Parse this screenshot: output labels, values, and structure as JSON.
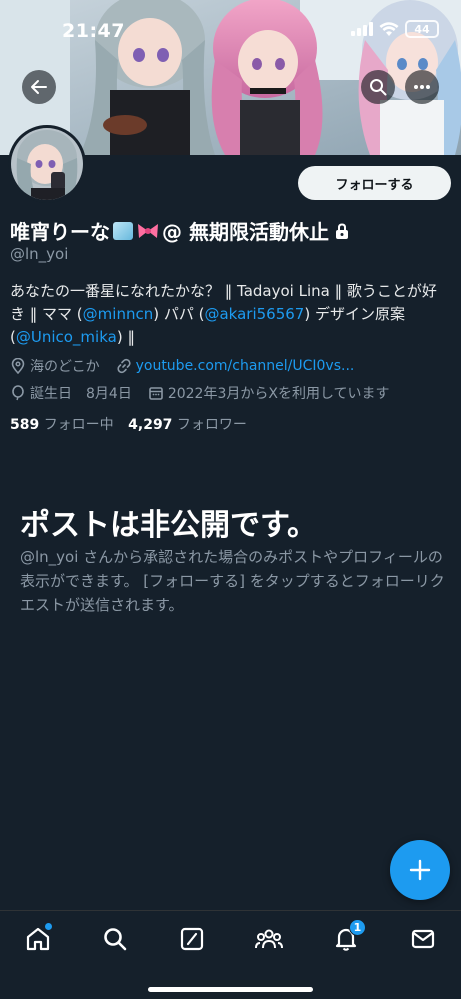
{
  "status_bar": {
    "time": "21:47",
    "battery": "44"
  },
  "header": {
    "back_icon": "arrow-left-icon",
    "search_icon": "search-icon",
    "more_icon": "more-horizontal-icon"
  },
  "profile": {
    "follow_label": "フォローする",
    "display_name_part1": "唯宵りーな",
    "display_name_part2": "@ 無期限活動休止",
    "handle": "@ln_yoi",
    "bio_text_1": "あなたの一番星になれたかな？ ‖ Tadayoi Lina ‖ 歌うことが好き ‖ ママ (",
    "bio_mention_1": "@minncn",
    "bio_text_2": ") パパ (",
    "bio_mention_2": "@akari56567",
    "bio_text_3": ") デザイン原案 (",
    "bio_mention_3": "@Unico_mika",
    "bio_text_4": ") ‖",
    "location": "海のどこか",
    "website": "youtube.com/channel/UCI0vs...",
    "birthday": "誕生日　8月4日",
    "joined": "2022年3月からXを利用しています",
    "following_count": "589",
    "following_label": "フォロー中",
    "followers_count": "4,297",
    "followers_label": "フォロワー"
  },
  "protected": {
    "title": "ポストは非公開です。",
    "description": "@ln_yoi さんから承認された場合のみポストやプロフィールの表示ができます。 [フォローする] をタップするとフォローリクエストが送信されます。"
  },
  "bottom_nav": {
    "items": [
      {
        "icon": "home-icon"
      },
      {
        "icon": "search-icon"
      },
      {
        "icon": "grok-icon"
      },
      {
        "icon": "communities-icon"
      },
      {
        "icon": "notifications-icon",
        "badge": "1"
      },
      {
        "icon": "messages-icon"
      }
    ]
  },
  "colors": {
    "background": "#15202b",
    "accent": "#1d9bf0",
    "muted_text": "#8b98a5"
  }
}
